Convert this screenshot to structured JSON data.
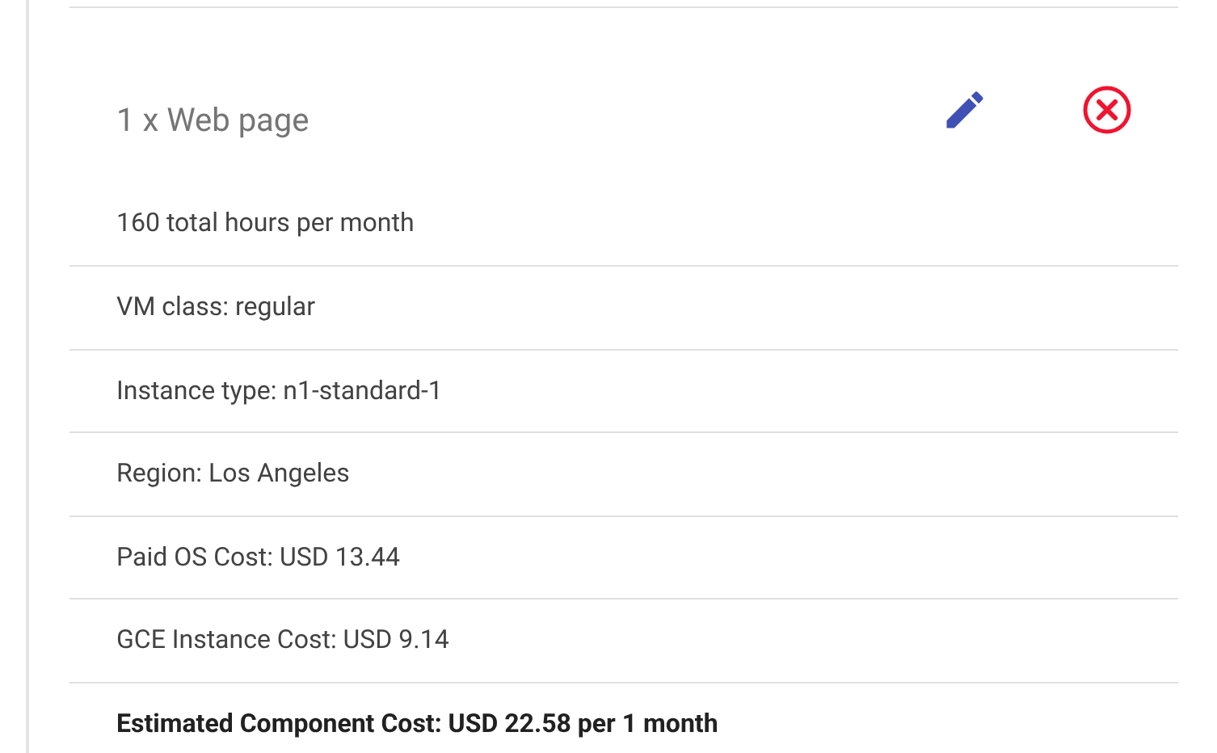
{
  "item": {
    "title": "1 x Web page",
    "details": [
      {
        "text": "160 total hours per month",
        "kind": "detail"
      },
      {
        "text": "VM class: regular",
        "kind": "detail"
      },
      {
        "text": "Instance type: n1-standard-1",
        "kind": "detail"
      },
      {
        "text": "Region: Los Angeles",
        "kind": "detail"
      },
      {
        "text": "Paid OS Cost: USD 13.44",
        "kind": "detail"
      },
      {
        "text": "GCE Instance Cost: USD 9.14",
        "kind": "detail"
      },
      {
        "text": "Estimated Component Cost: USD 22.58 per 1 month",
        "kind": "total"
      }
    ]
  }
}
